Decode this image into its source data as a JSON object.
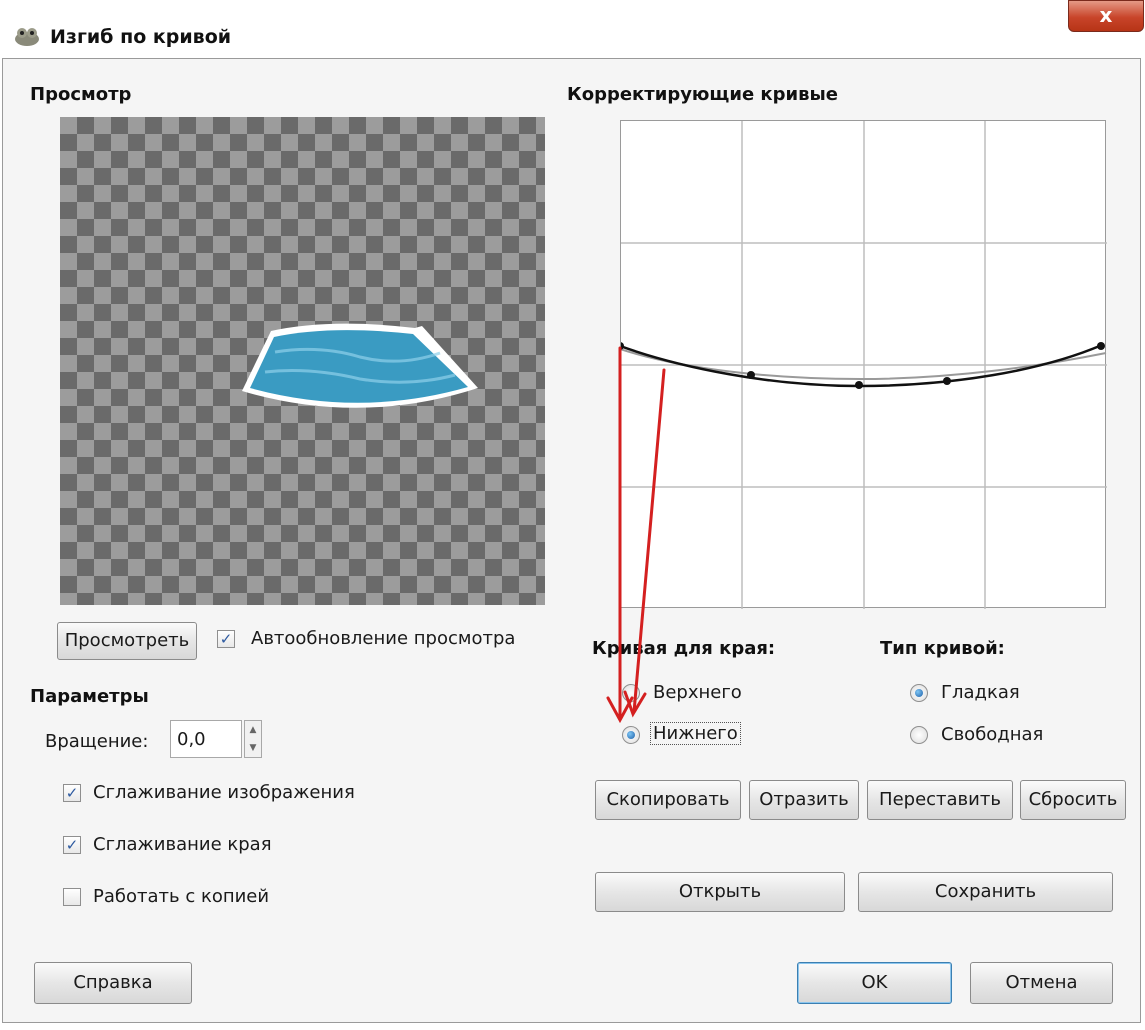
{
  "window": {
    "title": "Изгиб по кривой",
    "close_label": "x"
  },
  "preview": {
    "heading": "Просмотр",
    "preview_button": "Просмотреть",
    "auto_update": {
      "label": "Автообновление просмотра",
      "checked": true
    }
  },
  "params": {
    "heading": "Параметры",
    "rotation_label": "Вращение:",
    "rotation_value": "0,0",
    "checkboxes": [
      {
        "label": "Сглаживание изображения",
        "checked": true
      },
      {
        "label": "Сглаживание края",
        "checked": true
      },
      {
        "label": "Работать с копией",
        "checked": false
      }
    ]
  },
  "curves": {
    "heading": "Корректирующие кривые",
    "edge_heading": "Кривая для края:",
    "edge_options": [
      {
        "label": "Верхнего",
        "selected": false
      },
      {
        "label": "Нижнего",
        "selected": true
      }
    ],
    "type_heading": "Тип кривой:",
    "type_options": [
      {
        "label": "Гладкая",
        "selected": true
      },
      {
        "label": "Свободная",
        "selected": false
      }
    ],
    "actions": [
      "Скопировать",
      "Отразить",
      "Переставить",
      "Сбросить"
    ],
    "open_label": "Открыть",
    "save_label": "Сохранить"
  },
  "footer": {
    "help_label": "Справка",
    "ok_label": "OK",
    "cancel_label": "Отмена"
  },
  "colors": {
    "annotation_arrow": "#d42020",
    "preview_shape": "#3a9bc2"
  }
}
